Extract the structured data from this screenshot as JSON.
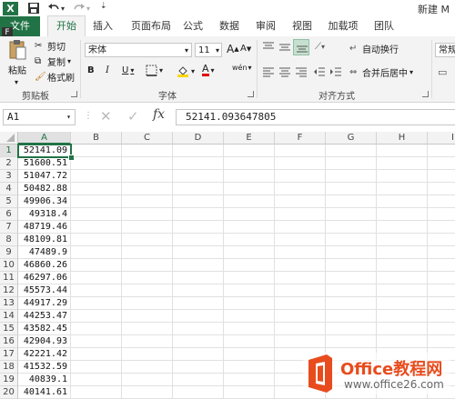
{
  "app": {
    "logo_letter": "X",
    "window_title": "新建 M",
    "accent": "#217346"
  },
  "quick_access": {
    "save_icon": "save-icon",
    "undo_icon": "undo-icon",
    "redo_icon": "redo-icon"
  },
  "tabs": [
    {
      "label": "文件"
    },
    {
      "label": "开始"
    },
    {
      "label": "插入"
    },
    {
      "label": "页面布局"
    },
    {
      "label": "公式"
    },
    {
      "label": "数据"
    },
    {
      "label": "审阅"
    },
    {
      "label": "视图"
    },
    {
      "label": "加载项"
    },
    {
      "label": "团队"
    }
  ],
  "file_tooltip": "F",
  "ribbon": {
    "clipboard": {
      "paste": "粘贴",
      "cut": "剪切",
      "copy": "复制",
      "format_painter": "格式刷",
      "label": "剪贴板"
    },
    "font": {
      "name": "宋体",
      "size": "11",
      "bold": "B",
      "italic": "I",
      "underline": "U",
      "grow": "A",
      "shrink": "A",
      "label": "字体",
      "phonetic": "wén"
    },
    "alignment": {
      "wrap": "自动换行",
      "merge": "合并后居中",
      "label": "对齐方式"
    },
    "number": {
      "format": "常规"
    }
  },
  "formula_bar": {
    "name_box": "A1",
    "fx": "fx",
    "value": "52141.093647805"
  },
  "columns": [
    "A",
    "B",
    "C",
    "D",
    "E",
    "F",
    "G",
    "H",
    "I"
  ],
  "rows": [
    {
      "n": "1",
      "a": "52141.09"
    },
    {
      "n": "2",
      "a": "51600.51"
    },
    {
      "n": "3",
      "a": "51047.72"
    },
    {
      "n": "4",
      "a": "50482.88"
    },
    {
      "n": "5",
      "a": "49906.34"
    },
    {
      "n": "6",
      "a": "49318.4"
    },
    {
      "n": "7",
      "a": "48719.46"
    },
    {
      "n": "8",
      "a": "48109.81"
    },
    {
      "n": "9",
      "a": "47489.9"
    },
    {
      "n": "10",
      "a": "46860.26"
    },
    {
      "n": "11",
      "a": "46297.06"
    },
    {
      "n": "12",
      "a": "45573.44"
    },
    {
      "n": "13",
      "a": "44917.29"
    },
    {
      "n": "14",
      "a": "44253.47"
    },
    {
      "n": "15",
      "a": "43582.45"
    },
    {
      "n": "16",
      "a": "42904.93"
    },
    {
      "n": "17",
      "a": "42221.42"
    },
    {
      "n": "18",
      "a": "41532.59"
    },
    {
      "n": "19",
      "a": "40839.1"
    },
    {
      "n": "20",
      "a": "40141.61"
    }
  ],
  "watermark": {
    "brand": "Office教程网",
    "url": "www.office26.com"
  }
}
